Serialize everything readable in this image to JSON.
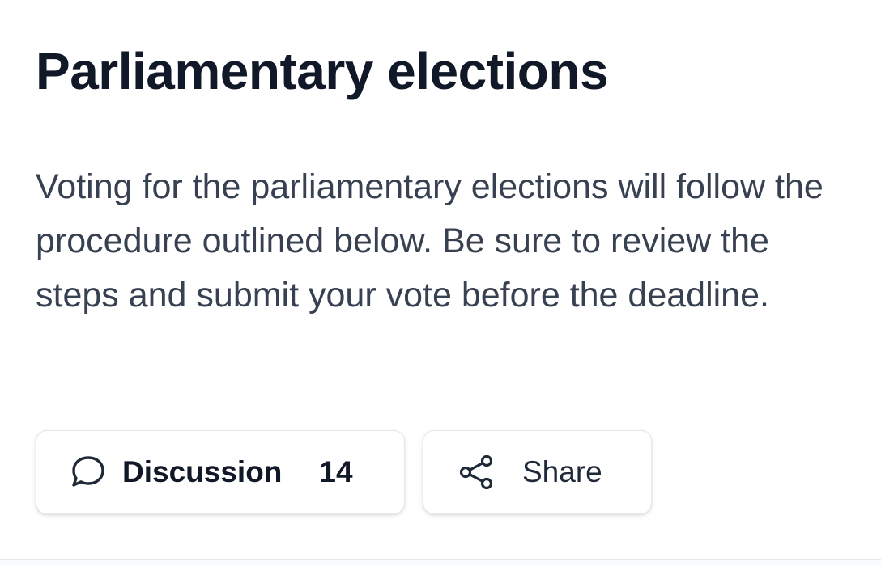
{
  "post": {
    "title": "Parliamentary elections",
    "description": "Voting for the parliamentary elections will follow the procedure outlined below. Be sure to review the steps and submit your vote before the deadline."
  },
  "actions": {
    "discussion": {
      "icon": "speech-bubble-icon",
      "label": "Discussion",
      "count": "14"
    },
    "share": {
      "icon": "share-icon",
      "label": "Share"
    }
  },
  "colors": {
    "title": "#111827",
    "body_text": "#374151",
    "button_border": "#e5e7eb",
    "background": "#ffffff"
  }
}
